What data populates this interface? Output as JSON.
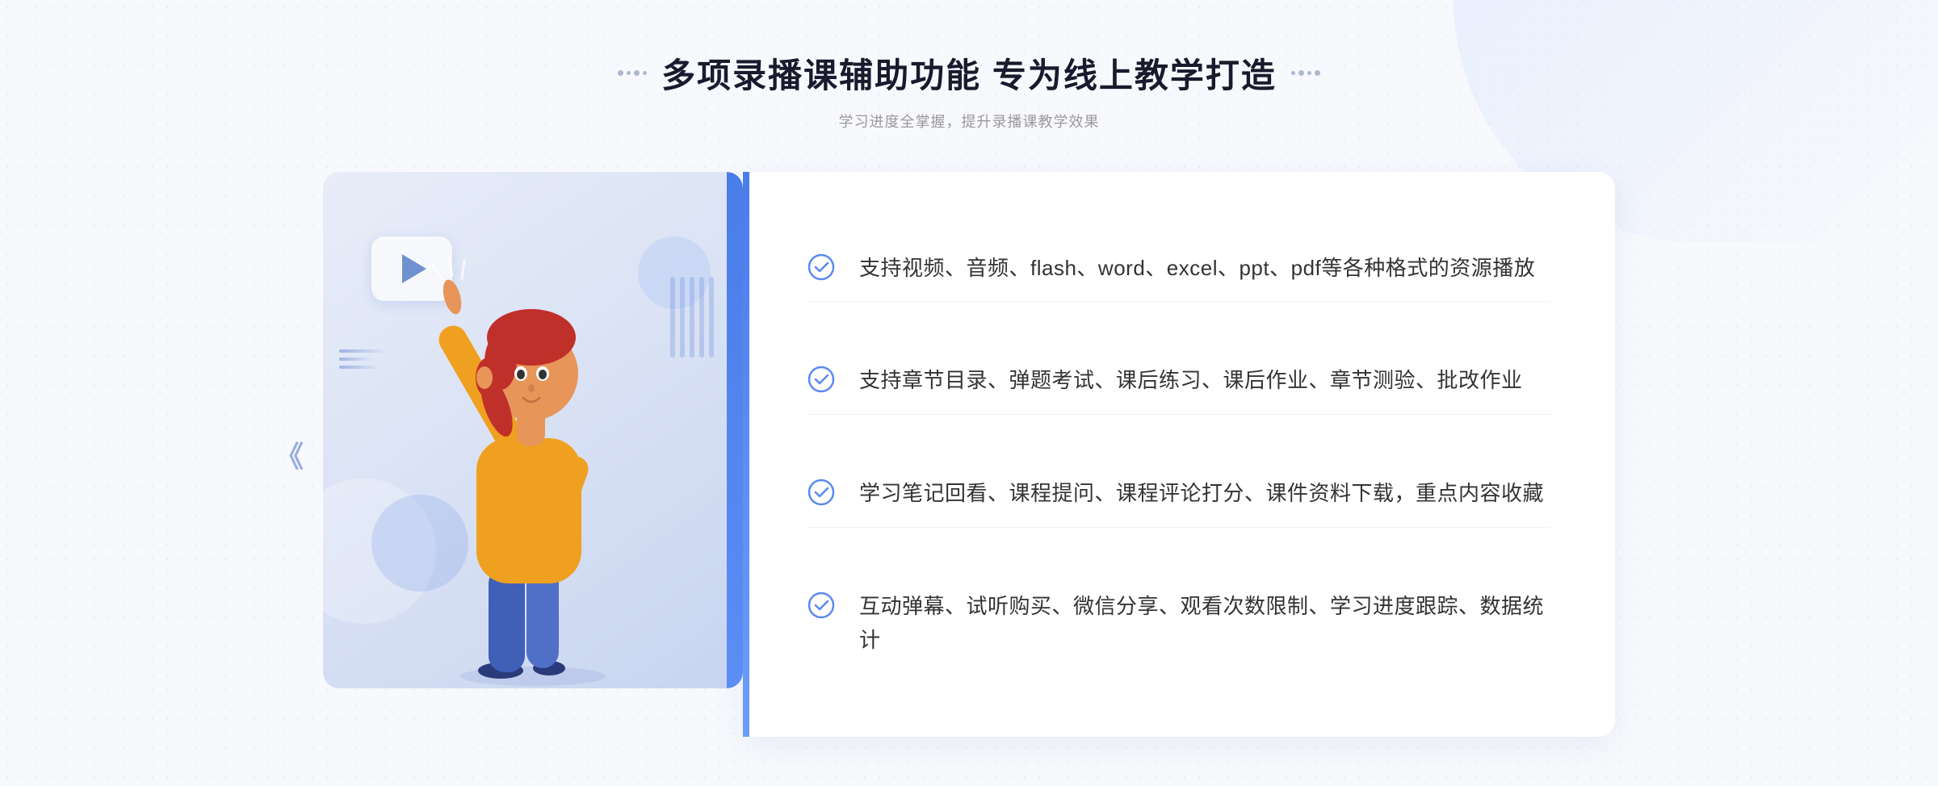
{
  "header": {
    "title": "多项录播课辅助功能 专为线上教学打造",
    "subtitle": "学习进度全掌握，提升录播课教学效果"
  },
  "features": [
    {
      "id": "feature-1",
      "text": "支持视频、音频、flash、word、excel、ppt、pdf等各种格式的资源播放"
    },
    {
      "id": "feature-2",
      "text": "支持章节目录、弹题考试、课后练习、课后作业、章节测验、批改作业"
    },
    {
      "id": "feature-3",
      "text": "学习笔记回看、课程提问、课程评论打分、课件资料下载，重点内容收藏"
    },
    {
      "id": "feature-4",
      "text": "互动弹幕、试听购买、微信分享、观看次数限制、学习进度跟踪、数据统计"
    }
  ],
  "icons": {
    "check": "check-circle-icon",
    "play": "play-icon",
    "chevron": "chevron-right-icon"
  },
  "colors": {
    "primary": "#4a7de8",
    "primary_light": "#6b9df8",
    "text_dark": "#1a1a2e",
    "text_medium": "#333333",
    "text_light": "#999999",
    "check_color": "#5b8aee",
    "bg_card": "#dce4f5",
    "border_light": "#f0f2f8"
  },
  "decorative": {
    "chevron_symbol": "《",
    "decorative_dots_left": "⁘",
    "decorative_dots_right": "⁘"
  }
}
